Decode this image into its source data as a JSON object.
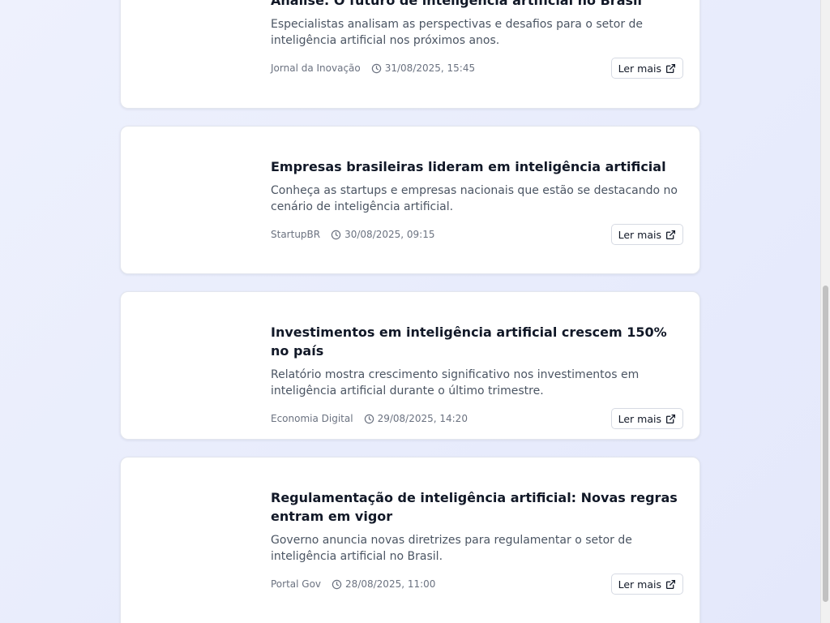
{
  "articles": [
    {
      "title": "Análise: O futuro de inteligência artificial no Brasil",
      "summary": "Especialistas analisam as perspectivas e desafios para o setor de inteligência artificial nos próximos anos.",
      "source": "Jornal da Inovação",
      "datetime": "31/08/2025, 15:45",
      "read_more_label": "Ler mais"
    },
    {
      "title": "Empresas brasileiras lideram em inteligência artificial",
      "summary": "Conheça as startups e empresas nacionais que estão se destacando no cenário de inteligência artificial.",
      "source": "StartupBR",
      "datetime": "30/08/2025, 09:15",
      "read_more_label": "Ler mais"
    },
    {
      "title": "Investimentos em inteligência artificial crescem 150% no país",
      "summary": "Relatório mostra crescimento significativo nos investimentos em inteligência artificial durante o último trimestre.",
      "source": "Economia Digital",
      "datetime": "29/08/2025, 14:20",
      "read_more_label": "Ler mais"
    },
    {
      "title": "Regulamentação de inteligência artificial: Novas regras entram em vigor",
      "summary": "Governo anuncia novas diretrizes para regulamentar o setor de inteligência artificial no Brasil.",
      "source": "Portal Gov",
      "datetime": "28/08/2025, 11:00",
      "read_more_label": "Ler mais"
    }
  ],
  "icons": {
    "time": "clock-icon",
    "read_more": "external-link-icon"
  }
}
